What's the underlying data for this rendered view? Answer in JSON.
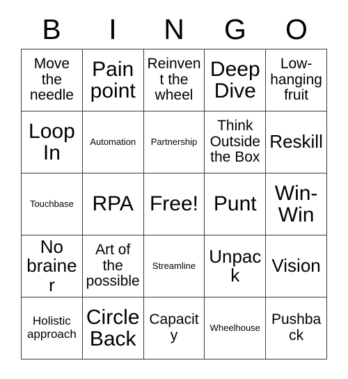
{
  "card": {
    "title": "BINGO",
    "header_letters": [
      "B",
      "I",
      "N",
      "G",
      "O"
    ],
    "grid_size": 5,
    "free_space": "Free!",
    "colors": {
      "background": "#ffffff",
      "text": "#000000",
      "grid_line": "#3b3b3b"
    },
    "rows": [
      [
        {
          "label": "Move the needle",
          "size": "md"
        },
        {
          "label": "Pain point",
          "size": "xl"
        },
        {
          "label": "Reinvent the wheel",
          "size": "md"
        },
        {
          "label": "Deep Dive",
          "size": "xl"
        },
        {
          "label": "Low-hanging fruit",
          "size": "md"
        }
      ],
      [
        {
          "label": "Loop In",
          "size": "xl"
        },
        {
          "label": "Automation",
          "size": "xs"
        },
        {
          "label": "Partnership",
          "size": "xs"
        },
        {
          "label": "Think Outside the Box",
          "size": "md"
        },
        {
          "label": "Reskill",
          "size": "lg"
        }
      ],
      [
        {
          "label": "Touchbase",
          "size": "xs"
        },
        {
          "label": "RPA",
          "size": "xl"
        },
        {
          "label": "Free!",
          "size": "xl"
        },
        {
          "label": "Punt",
          "size": "xl"
        },
        {
          "label": "Win-Win",
          "size": "xl"
        }
      ],
      [
        {
          "label": "No brainer",
          "size": "lg"
        },
        {
          "label": "Art of the possible",
          "size": "md"
        },
        {
          "label": "Streamline",
          "size": "xs"
        },
        {
          "label": "Unpack",
          "size": "lg"
        },
        {
          "label": "Vision",
          "size": "lg"
        }
      ],
      [
        {
          "label": "Holistic approach",
          "size": "sm"
        },
        {
          "label": "Circle Back",
          "size": "xl"
        },
        {
          "label": "Capacity",
          "size": "md"
        },
        {
          "label": "Wheelhouse",
          "size": "xs"
        },
        {
          "label": "Pushback",
          "size": "md"
        }
      ]
    ]
  }
}
